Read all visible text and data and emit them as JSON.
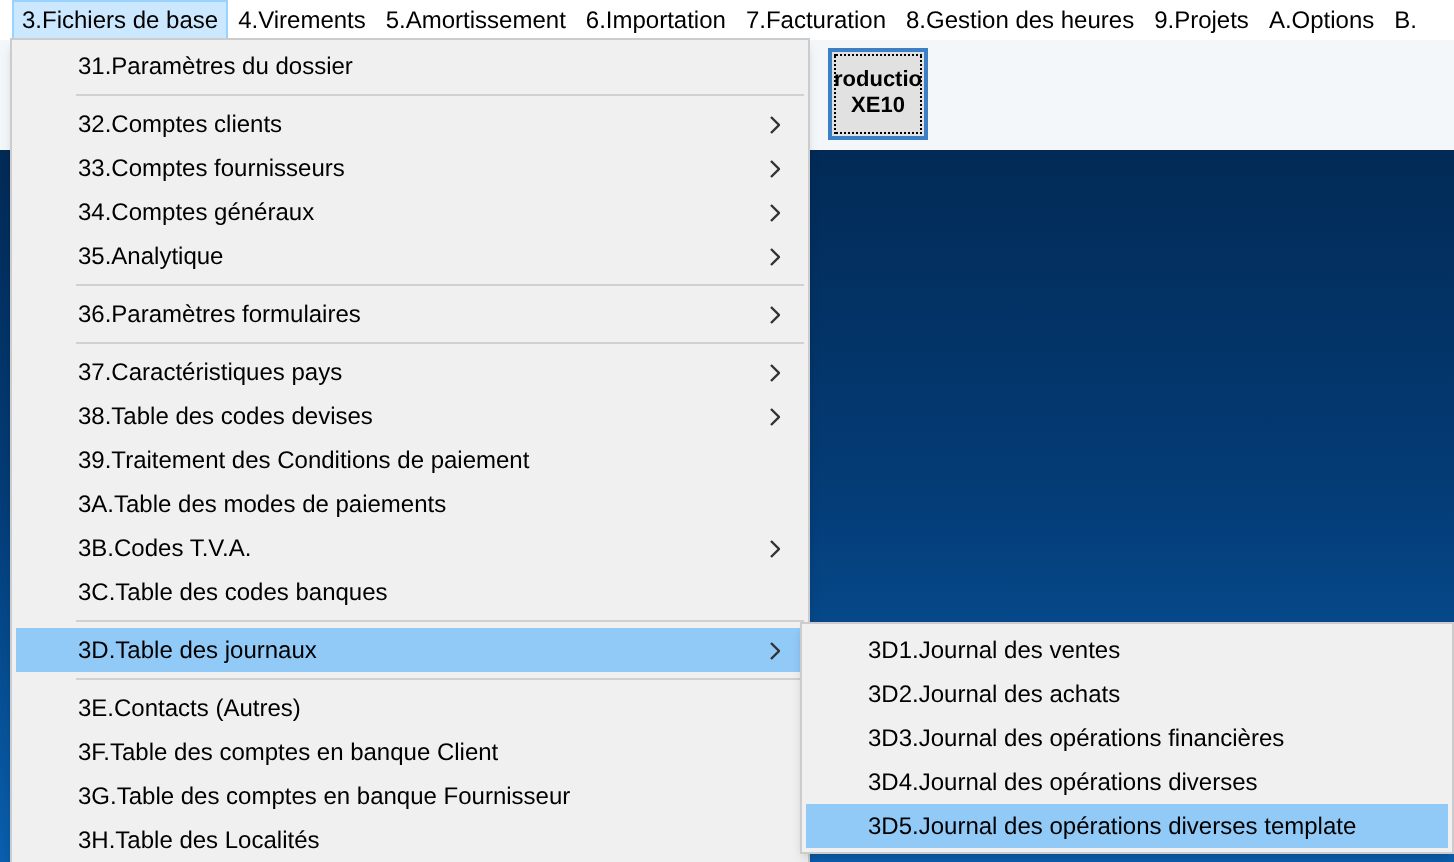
{
  "menubar": [
    {
      "label": "3.Fichiers de base",
      "selected": true
    },
    {
      "label": "4.Virements",
      "selected": false
    },
    {
      "label": "5.Amortissement",
      "selected": false
    },
    {
      "label": "6.Importation",
      "selected": false
    },
    {
      "label": "7.Facturation",
      "selected": false
    },
    {
      "label": "8.Gestion des heures",
      "selected": false
    },
    {
      "label": "9.Projets",
      "selected": false
    },
    {
      "label": "A.Options",
      "selected": false
    },
    {
      "label": "B.",
      "selected": false
    }
  ],
  "toolbar_button": {
    "lines": [
      "roductio",
      "XE10"
    ]
  },
  "menu": [
    {
      "kind": "item",
      "label": "31.Paramètres du dossier",
      "submenu": false,
      "selected": false
    },
    {
      "kind": "separator"
    },
    {
      "kind": "item",
      "label": "32.Comptes clients",
      "submenu": true,
      "selected": false
    },
    {
      "kind": "item",
      "label": "33.Comptes fournisseurs",
      "submenu": true,
      "selected": false
    },
    {
      "kind": "item",
      "label": "34.Comptes généraux",
      "submenu": true,
      "selected": false
    },
    {
      "kind": "item",
      "label": "35.Analytique",
      "submenu": true,
      "selected": false
    },
    {
      "kind": "separator"
    },
    {
      "kind": "item",
      "label": "36.Paramètres formulaires",
      "submenu": true,
      "selected": false
    },
    {
      "kind": "separator"
    },
    {
      "kind": "item",
      "label": "37.Caractéristiques pays",
      "submenu": true,
      "selected": false
    },
    {
      "kind": "item",
      "label": "38.Table des codes devises",
      "submenu": true,
      "selected": false
    },
    {
      "kind": "item",
      "label": "39.Traitement des Conditions de paiement",
      "submenu": false,
      "selected": false
    },
    {
      "kind": "item",
      "label": "3A.Table des modes de paiements",
      "submenu": false,
      "selected": false
    },
    {
      "kind": "item",
      "label": "3B.Codes T.V.A.",
      "submenu": true,
      "selected": false
    },
    {
      "kind": "item",
      "label": "3C.Table des codes banques",
      "submenu": false,
      "selected": false
    },
    {
      "kind": "separator"
    },
    {
      "kind": "item",
      "label": "3D.Table des journaux",
      "submenu": true,
      "selected": true
    },
    {
      "kind": "separator"
    },
    {
      "kind": "item",
      "label": "3E.Contacts (Autres)",
      "submenu": false,
      "selected": false
    },
    {
      "kind": "item",
      "label": "3F.Table des comptes en banque Client",
      "submenu": false,
      "selected": false
    },
    {
      "kind": "item",
      "label": "3G.Table des comptes en banque Fournisseur",
      "submenu": false,
      "selected": false
    },
    {
      "kind": "item",
      "label": "3H.Table des Localités",
      "submenu": false,
      "selected": false
    }
  ],
  "submenu": [
    {
      "label": "3D1.Journal des ventes",
      "selected": false
    },
    {
      "label": "3D2.Journal des achats",
      "selected": false
    },
    {
      "label": "3D3.Journal des opérations financières",
      "selected": false
    },
    {
      "label": "3D4.Journal des opérations diverses",
      "selected": false
    },
    {
      "label": "3D5.Journal des opérations diverses template",
      "selected": true
    }
  ]
}
